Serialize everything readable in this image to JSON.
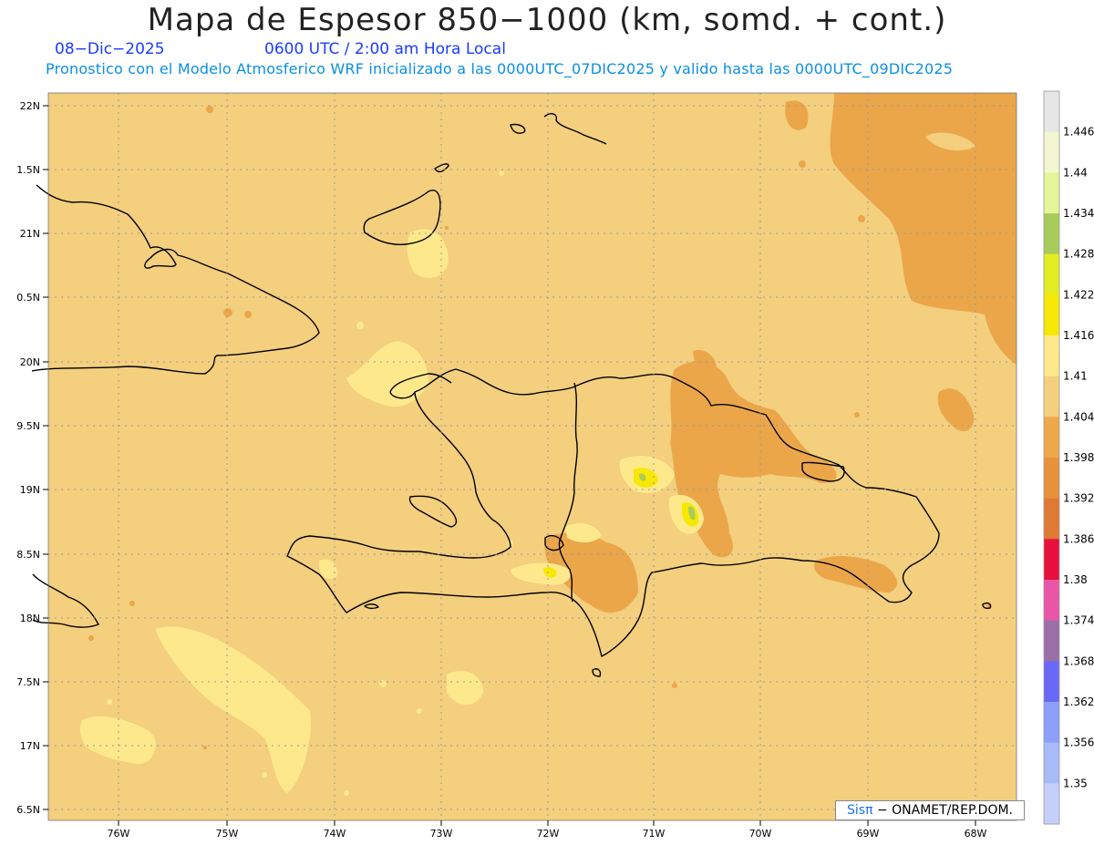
{
  "title": "Mapa de Espesor 850−1000 (km, somd. + cont.)",
  "date": "08−Dic−2025",
  "time": "0600 UTC / 2:00 am Hora Local",
  "forecast": "Pronostico con el Modelo Atmosferico WRF inicializado a las 0000UTC_07DIC2025 y valido hasta las  0000UTC_09DIC2025",
  "credit": {
    "sis": "Sis",
    "pi": "π",
    "rest": "− ONAMET/REP.DOM."
  },
  "lat_labels": [
    "22N",
    "1.5N",
    "21N",
    "0.5N",
    "20N",
    "9.5N",
    "19N",
    "8.5N",
    "18N",
    "7.5N",
    "17N",
    "6.5N"
  ],
  "lon_labels": [
    "76W",
    "75W",
    "74W",
    "73W",
    "72W",
    "71W",
    "70W",
    "69W",
    "68W"
  ],
  "colorbar": {
    "labels": [
      "1.446",
      "1.44",
      "1.434",
      "1.428",
      "1.422",
      "1.416",
      "1.41",
      "1.404",
      "1.398",
      "1.392",
      "1.386",
      "1.38",
      "1.374",
      "1.368",
      "1.362",
      "1.356",
      "1.35"
    ],
    "colors": [
      "#e6e6e6",
      "#f3f6d0",
      "#e4f59a",
      "#a8cc5c",
      "#e3ed21",
      "#f8e805",
      "#fde98c",
      "#f3cf7e",
      "#eea84a",
      "#e8913c",
      "#df7a35",
      "#e8103c",
      "#e955a7",
      "#9a70a8",
      "#6a69f7",
      "#8c9ffb",
      "#a9baf9",
      "#c6cefa"
    ]
  },
  "field": {
    "background": "#f3cf7e",
    "level_low": "#eba64a",
    "level_high": "#fde98c",
    "level_peak": "#f8e805",
    "level_green": "#a8cc5c"
  },
  "map": {
    "lat_range": [
      16.32,
      22.1
    ],
    "lon_range": [
      -76.67,
      -67.63
    ],
    "grid": "dotted"
  }
}
